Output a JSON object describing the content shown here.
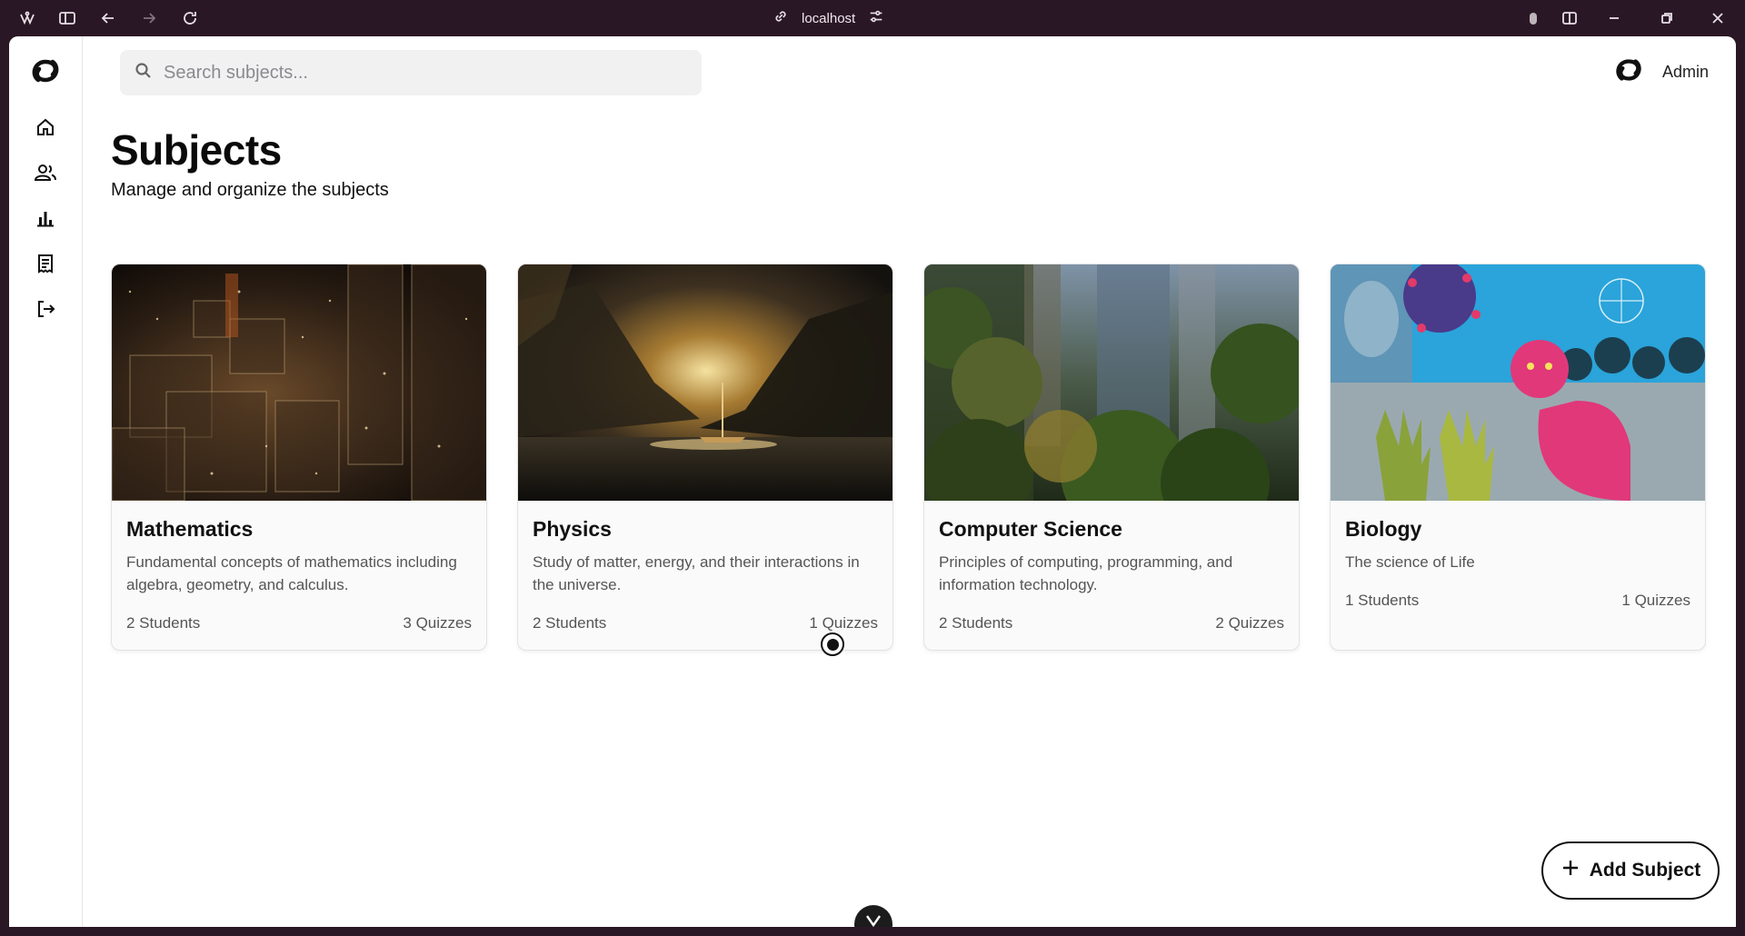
{
  "browser": {
    "url": "localhost",
    "icons": [
      "app-menu-icon",
      "sidebar-toggle-icon",
      "back-icon",
      "forward-icon",
      "reload-icon",
      "link-icon",
      "site-settings-icon",
      "extension-icon",
      "split-view-icon",
      "minimize-icon",
      "maximize-icon",
      "close-icon"
    ]
  },
  "sidebar": {
    "items": [
      {
        "name": "home",
        "icon": "home-icon"
      },
      {
        "name": "users",
        "icon": "users-icon"
      },
      {
        "name": "analytics",
        "icon": "bar-chart-icon"
      },
      {
        "name": "reports",
        "icon": "receipt-icon"
      },
      {
        "name": "logout",
        "icon": "logout-icon"
      }
    ]
  },
  "search": {
    "placeholder": "Search subjects..."
  },
  "user": {
    "name": "Admin"
  },
  "page": {
    "title": "Subjects",
    "subtitle": "Manage and organize the subjects"
  },
  "subjects": [
    {
      "name": "Mathematics",
      "description": "Fundamental concepts of mathematics including algebra, geometry, and calculus.",
      "students": "2 Students",
      "quizzes": "3 Quizzes"
    },
    {
      "name": "Physics",
      "description": "Study of matter, energy, and their interactions in the universe.",
      "students": "2 Students",
      "quizzes": "1 Quizzes"
    },
    {
      "name": "Computer Science",
      "description": "Principles of computing, programming, and information technology.",
      "students": "2 Students",
      "quizzes": "2 Quizzes"
    },
    {
      "name": "Biology",
      "description": "The science of Life",
      "students": "1 Students",
      "quizzes": "1 Quizzes"
    }
  ],
  "actions": {
    "add_subject": "Add Subject"
  }
}
